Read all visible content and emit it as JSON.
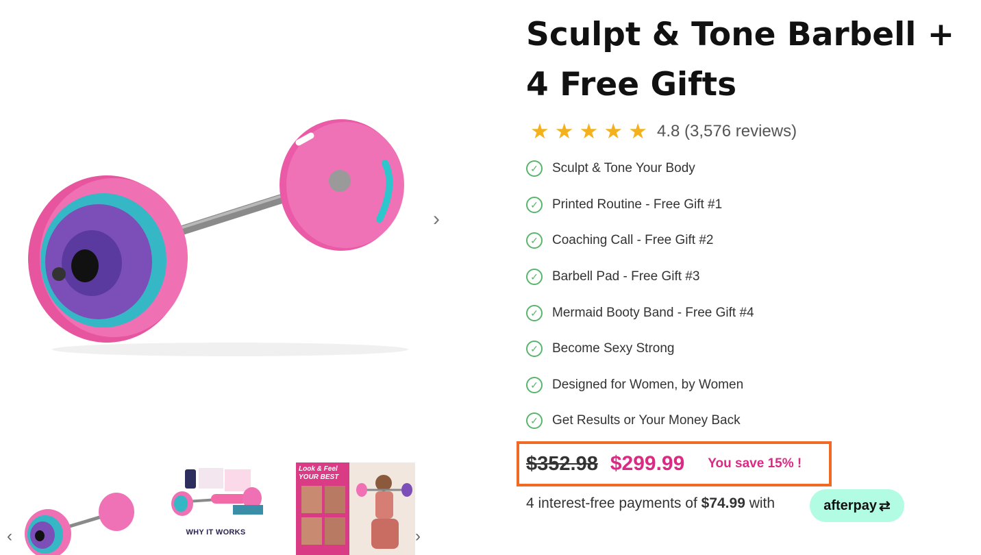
{
  "gallery": {
    "main_image_alt": "Pink barbell with pink, teal and purple plates",
    "next_arrow": "›",
    "thumb_prev": "‹",
    "thumb_next": "›",
    "thumbnails": [
      {
        "alt": "Barbell thumbnail"
      },
      {
        "alt": "Why it works thumbnail",
        "caption": "WHY IT WORKS"
      },
      {
        "alt": "Look & Feel Your Best thumbnail",
        "caption": "Look & Feel YOUR BEST"
      }
    ]
  },
  "product": {
    "title": "Sculpt & Tone Barbell + 4 Free Gifts",
    "rating": {
      "stars": 5,
      "star_icon": "★",
      "text": "4.8 (3,576 reviews)"
    },
    "features": [
      "Sculpt & Tone Your Body",
      "Printed Routine - Free Gift #1",
      "Coaching Call - Free Gift #2",
      "Barbell Pad - Free Gift #3",
      "Mermaid Booty Band - Free Gift #4",
      "Become Sexy Strong",
      "Designed for Women, by Women",
      "Get Results or Your Money Back"
    ],
    "pricing": {
      "old_price": "$352.98",
      "new_price": "$299.99",
      "save_text": "You save 15% !",
      "installments_prefix": "4 interest-free payments of",
      "installment_amount": "$74.99",
      "installments_suffix": "with",
      "afterpay_label": "afterpay"
    }
  },
  "colors": {
    "accent_pink": "#d92b83",
    "star": "#f3b21d",
    "check": "#58b56b",
    "highlight_border": "#ef6a24",
    "afterpay_bg": "#b2fce4"
  }
}
